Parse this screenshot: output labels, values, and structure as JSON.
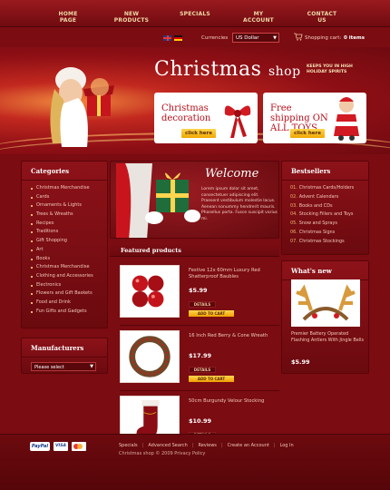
{
  "nav": {
    "items": [
      "HOME PAGE",
      "NEW PRODUCTS",
      "SPECIALS",
      "MY ACCOUNT",
      "CONTACT US"
    ]
  },
  "util": {
    "currency_label": "Currencies",
    "currency_value": "US Dollar",
    "cart_label": "Shopping cart:",
    "cart_count": "0 items"
  },
  "header": {
    "title_main": "Christmas",
    "title_shop": "shop",
    "tagline": "KEEPS YOU IN HIGH HOLIDAY SPIRITS",
    "promo1_title": "Christmas decoration",
    "promo2_title": "Free shipping ON ALL TOYS",
    "promo_button": "click here"
  },
  "categories": {
    "title": "Categories",
    "items": [
      "Christmas Merchandise",
      "Cards",
      "Ornaments & Lights",
      "Trees & Wreaths",
      "Recipes",
      "Traditions",
      "Gift Shopping",
      "Art",
      "Books",
      "Christmas Merchandise",
      "Clothing and Accessories",
      "Electronics",
      "Flowers and Gift Baskets",
      "Food and Drink",
      "Fun Gifts and Gadgets"
    ]
  },
  "manufacturers": {
    "title": "Manufacturers",
    "select_value": "Please select"
  },
  "welcome": {
    "title": "Welcome",
    "text": "Lorem ipsum dolor sit amet, consectetuer adipiscing elit. Praesent vestibulum molestie lacus. Aenean nonummy hendrerit mauris. Phasellus porta. Fusce suscipit varius mi."
  },
  "featured": {
    "title": "Featured products",
    "details_label": "DETAILS",
    "cart_label": "ADD TO CART",
    "products": [
      {
        "name": "Festive 12x 60mm Luxury Red Shatterproof Baubles",
        "price": "$5.99"
      },
      {
        "name": "16 Inch Red Berry & Cone Wreath",
        "price": "$17.99"
      },
      {
        "name": "50cm Burgundy Velour Stocking",
        "price": "$10.99"
      }
    ]
  },
  "bestsellers": {
    "title": "Bestsellers",
    "items": [
      {
        "num": "01.",
        "label": "Christmas Cards/Holders"
      },
      {
        "num": "02.",
        "label": "Advent Calendars"
      },
      {
        "num": "03.",
        "label": "Books and CDs"
      },
      {
        "num": "04.",
        "label": "Stocking Fillers and Toys"
      },
      {
        "num": "05.",
        "label": "Snow and Sprays"
      },
      {
        "num": "06.",
        "label": "Christmas Signs"
      },
      {
        "num": "07.",
        "label": "Christmas Stockings"
      }
    ]
  },
  "whatsnew": {
    "title": "What's new",
    "name": "Premier Battery Operated Flashing Antlers With Jingle Bells",
    "price": "$5.99"
  },
  "footer": {
    "links": [
      "Specials",
      "Advanced Search",
      "Reviews",
      "Create an Account",
      "Log In"
    ],
    "copyright": "Christmas shop © 2009  Privacy Policy",
    "paypal": "PayPal",
    "visa": "VISA"
  },
  "colors": {
    "background": "#7a0c12",
    "accent_gold": "#f0a800",
    "promo_red": "#b30f1a"
  }
}
